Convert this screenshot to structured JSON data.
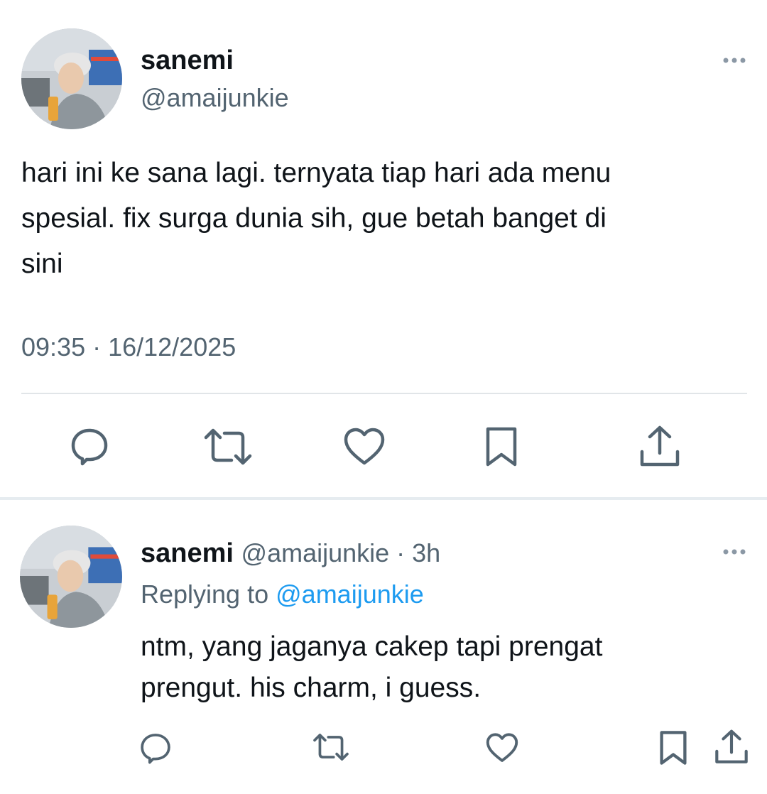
{
  "colors": {
    "text": "#0f1419",
    "muted": "#536471",
    "link": "#1d9bf0",
    "divider": "#e1e5e8"
  },
  "main_tweet": {
    "display_name": "sanemi",
    "handle": "@amaijunkie",
    "text_lines": [
      "hari ini ke sana lagi. ternyata tiap hari ada menu",
      "spesial. fix surga dunia sih, gue betah banget di",
      "sini"
    ],
    "timestamp": "09:35 · 16/12/2025",
    "more_icon": "more-horizontal-icon",
    "actions": [
      "reply-icon",
      "retweet-icon",
      "like-icon",
      "bookmark-icon",
      "share-icon"
    ]
  },
  "reply_tweet": {
    "display_name": "sanemi",
    "handle_time": "@amaijunkie · 3h",
    "replying_prefix": "Replying to",
    "replying_handle": "@amaijunkie",
    "text_lines": [
      "ntm, yang jaganya cakep tapi prengat",
      "prengut. his charm, i guess."
    ],
    "more_icon": "more-horizontal-icon",
    "actions": [
      "reply-icon",
      "retweet-icon",
      "like-icon",
      "bookmark-icon",
      "share-icon"
    ]
  }
}
